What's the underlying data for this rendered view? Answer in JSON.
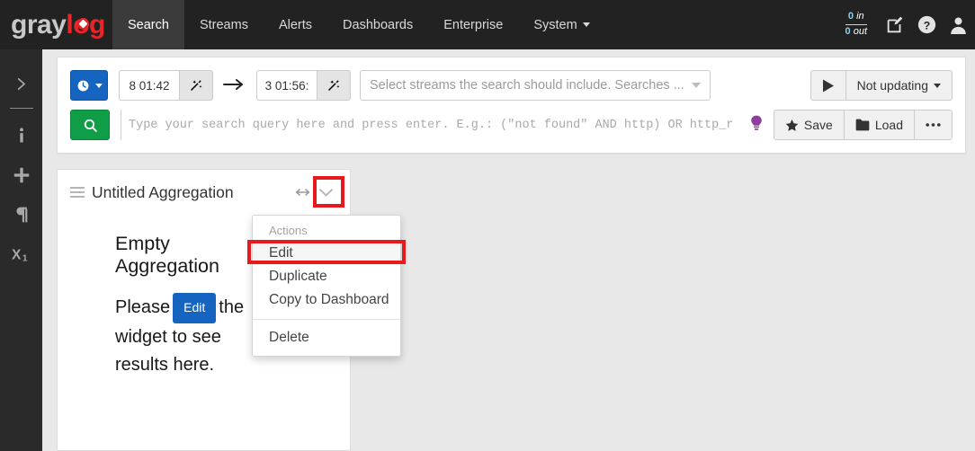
{
  "navbar": {
    "brand": {
      "first": "gray",
      "second": "log"
    },
    "items": [
      {
        "label": "Search",
        "active": true,
        "caret": false
      },
      {
        "label": "Streams",
        "active": false,
        "caret": false
      },
      {
        "label": "Alerts",
        "active": false,
        "caret": false
      },
      {
        "label": "Dashboards",
        "active": false,
        "caret": false
      },
      {
        "label": "Enterprise",
        "active": false,
        "caret": false
      },
      {
        "label": "System",
        "active": false,
        "caret": true
      }
    ],
    "throughput": {
      "in_value": "0",
      "in_label": "in",
      "out_value": "0",
      "out_label": "out"
    },
    "icons": [
      "edit-pencil-icon",
      "help-circle-icon",
      "user-avatar-icon"
    ]
  },
  "sidebar": {
    "items": [
      {
        "name": "expand-chevron-icon",
        "glyph": "chevron-right"
      },
      {
        "name": "info-icon",
        "glyph": "i"
      },
      {
        "name": "add-icon",
        "glyph": "+"
      },
      {
        "name": "pilcrow-icon",
        "glyph": "pilcrow"
      },
      {
        "name": "subscript-x1-icon",
        "glyph": "x1"
      }
    ]
  },
  "searchbar": {
    "timerange_button_label": "",
    "from_time": "8 01:42",
    "to_time": "3 01:56:",
    "arrow": "⟶",
    "streams_placeholder": "Select streams the search should include. Searches ...",
    "refresh_label": "Not updating",
    "play_label": "▶",
    "query_placeholder": "Type your search query here and press enter. E.g.: (\"not found\" AND http) OR http_r",
    "save_label": "Save",
    "load_label": "Load",
    "more_label": "•••"
  },
  "widget": {
    "title": "Untitled Aggregation",
    "empty_title": "Empty Aggregation",
    "desc_before": "Please",
    "edit_button_label": "Edit",
    "desc_after": "the widget to see results here."
  },
  "dropdown": {
    "header": "Actions",
    "items": [
      {
        "label": "Edit",
        "highlighted": true
      },
      {
        "label": "Duplicate",
        "highlighted": false
      },
      {
        "label": "Copy to Dashboard",
        "highlighted": false
      }
    ],
    "delete_label": "Delete"
  },
  "colors": {
    "brand_red": "#e8262a",
    "highlight_red": "#e8191c",
    "primary_blue": "#1565c0",
    "search_green": "#0f9d48",
    "navbar_dark": "#222222",
    "page_bg": "#e8e8e8"
  }
}
